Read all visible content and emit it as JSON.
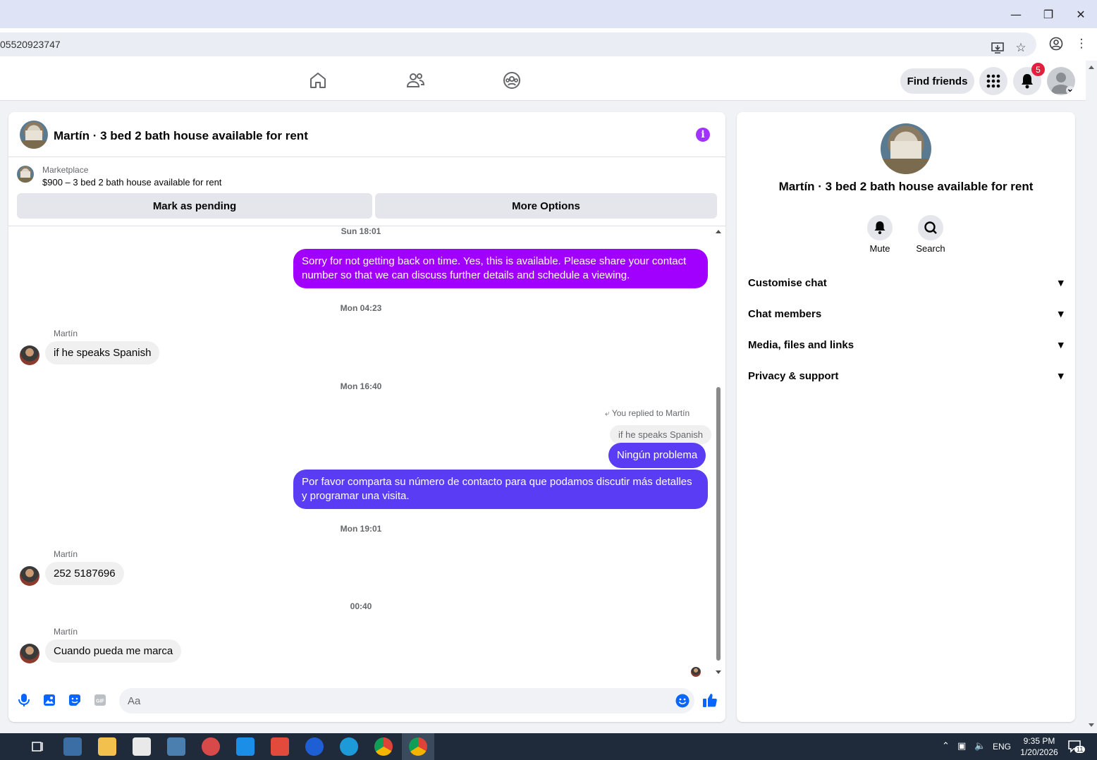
{
  "browser": {
    "url_fragment": "05520923747",
    "window_controls": [
      "minimize",
      "restore",
      "close"
    ]
  },
  "header": {
    "find_friends": "Find friends",
    "notification_count": "5",
    "nav_icons": [
      "home-icon",
      "friends-icon",
      "groups-icon"
    ]
  },
  "chat": {
    "title": "Martín · 3 bed 2 bath house available for rent",
    "marketplace_label": "Marketplace",
    "listing": "$900 – 3 bed 2 bath house available for rent",
    "mark_pending": "Mark as pending",
    "more_options": "More Options",
    "timestamps": [
      "Sun 18:01",
      "Mon 04:23",
      "Mon 16:40",
      "Mon 19:01",
      "00:40"
    ],
    "messages": [
      {
        "from": "me",
        "text": "Sorry for not getting back on time. Yes, this is available. Please share your contact number so that we can discuss further details and schedule a viewing."
      },
      {
        "from": "Martín",
        "text": "if he speaks Spanish"
      },
      {
        "from": "me",
        "text": "Ningún problema"
      },
      {
        "from": "me",
        "text": "Por favor comparta su número de contacto para que podamos discutir más detalles y programar una visita."
      },
      {
        "from": "Martín",
        "text": "252 5187696"
      },
      {
        "from": "Martín",
        "text": "Cuando pueda me marca"
      }
    ],
    "sender_name": "Martín",
    "reply_hint": "You replied to Martín",
    "reply_quote": "if he speaks Spanish",
    "input_placeholder": "Aa",
    "accent_color": "#a100ff",
    "accent_color_2": "#5b3cf5"
  },
  "info_panel": {
    "name": "Martín · 3 bed 2 bath house available for rent",
    "mute": "Mute",
    "search": "Search",
    "sections": [
      "Customise chat",
      "Chat members",
      "Media, files and links",
      "Privacy & support"
    ]
  },
  "taskbar": {
    "time": "9:35 PM",
    "date": "1/20/2026",
    "lang": "ENG",
    "notif_count": "11"
  }
}
